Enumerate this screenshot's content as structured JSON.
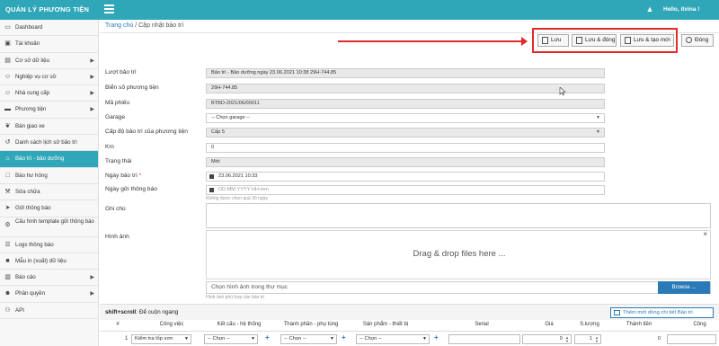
{
  "app": {
    "brand": "QUẢN LÝ PHƯƠNG TIỆN",
    "user_greeting": "Hello, itvina !"
  },
  "sidebar": {
    "items": [
      {
        "label": "Dashboard",
        "icon": "monitor-icon",
        "has_arrow": false
      },
      {
        "label": "Tài khoản",
        "icon": "image-icon",
        "has_arrow": false
      },
      {
        "label": "Cơ sở dữ liệu",
        "icon": "document-icon",
        "has_arrow": true
      },
      {
        "label": "Nghiệp vụ cơ sở",
        "icon": "user-icon",
        "has_arrow": true
      },
      {
        "label": "Nhà cung cấp",
        "icon": "user-icon",
        "has_arrow": true
      },
      {
        "label": "Phương tiện",
        "icon": "car-icon",
        "has_arrow": true
      },
      {
        "label": "Bàn giao xe",
        "icon": "handshake-icon",
        "has_arrow": false
      },
      {
        "label": "Danh sách lịch sử bảo trì",
        "icon": "history-icon",
        "has_arrow": false
      },
      {
        "label": "Bảo trì - bảo dưỡng",
        "icon": "garage-icon",
        "has_arrow": false,
        "active": true
      },
      {
        "label": "Báo hư hỏng",
        "icon": "file-icon",
        "has_arrow": false
      },
      {
        "label": "Sửa chữa",
        "icon": "wrench-icon",
        "has_arrow": false
      },
      {
        "label": "Gửi thông báo",
        "icon": "send-icon",
        "has_arrow": false
      },
      {
        "label": "Cấu hình template gửi thông báo",
        "icon": "settings-icon",
        "has_arrow": false
      },
      {
        "label": "Logs thông báo",
        "icon": "list-icon",
        "has_arrow": false
      },
      {
        "label": "Mẫu in (xuất) dữ liệu",
        "icon": "print-icon",
        "has_arrow": false
      },
      {
        "label": "Báo cáo",
        "icon": "chart-icon",
        "has_arrow": true
      },
      {
        "label": "Phân quyền",
        "icon": "users-icon",
        "has_arrow": true
      },
      {
        "label": "API",
        "icon": "api-icon",
        "has_arrow": false
      }
    ]
  },
  "breadcrumb": {
    "home": "Trang chủ",
    "separator": "/",
    "current": "Cập nhật bảo trì"
  },
  "toolbar": {
    "save": "Lưu",
    "save_close": "Lưu & đóng",
    "save_new": "Lưu & tạo mới",
    "close": "Đóng"
  },
  "form": {
    "luot_bao_tri": {
      "label": "Lượt bảo trì",
      "value": "Bảo trì - Bảo dưỡng ngày 23.06.2021 10:38 29H-744.85"
    },
    "bien_so": {
      "label": "Biển số phương tiện",
      "value": "29H-744.85"
    },
    "ma_phieu": {
      "label": "Mã phiếu",
      "value": "BTBD-2021/06/00011"
    },
    "garage": {
      "label": "Garage",
      "value": "-- Chọn garage --"
    },
    "cap_do": {
      "label": "Cấp độ bảo trì của phương tiện",
      "value": "Cấp 5"
    },
    "km": {
      "label": "Km",
      "value": "0"
    },
    "trang_thai": {
      "label": "Trạng thái",
      "value": "Mới"
    },
    "ngay_bao_tri": {
      "label": "Ngày bảo trì",
      "required_mark": "*",
      "value": "23.06.2021 10:33"
    },
    "ngay_gui": {
      "label": "Ngày gửi thông báo",
      "placeholder": "DD.MM.YYYY HH:mm",
      "hint": "Không được chọn quá 30 ngày"
    },
    "ghi_chu": {
      "label": "Ghi chú",
      "value": ""
    },
    "hinh_anh": {
      "label": "Hình ảnh",
      "dropzone_text": "Drag & drop files here ...",
      "file_placeholder": "Chọn hình ảnh trong thư mục",
      "browse": "Browse ...",
      "hint": "Hình ảnh phù hợp cần bảo trì"
    }
  },
  "table": {
    "scroll_hint_bold": "shift+scroll",
    "scroll_hint_rest": ": Để cuộn ngang",
    "add_button": "Thêm mới dòng chi tiết Bảo trì",
    "columns": [
      "#",
      "Công việc",
      "Kết cấu - hệ thống",
      "Thành phần - phụ tùng",
      "Sản phẩm - thiết bị",
      "Serial",
      "Giá",
      "S.lượng",
      "Thành tiền",
      "Công"
    ],
    "row": {
      "num": "1",
      "cong_viec": "Kiểm tra lốp xơn",
      "ket_cau": "-- Chọn --",
      "thanh_phan": "-- Chọn --",
      "san_pham": "-- Chọn --",
      "gia": "0",
      "so_luong": "1",
      "thanh_tien": "0"
    }
  }
}
